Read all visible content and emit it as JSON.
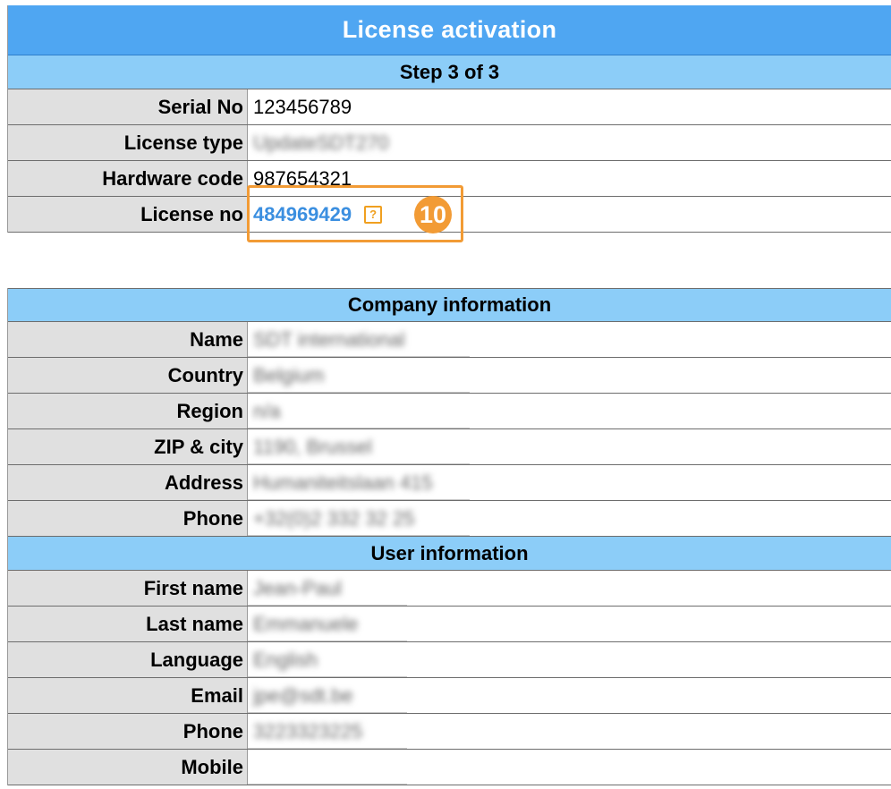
{
  "license": {
    "title": "License activation",
    "step": "Step 3 of 3",
    "rows": [
      {
        "label": "Serial No",
        "value": "123456789"
      },
      {
        "label": "License type",
        "value": "UpdateSDT270"
      },
      {
        "label": "Hardware code",
        "value": "987654321"
      },
      {
        "label": "License no",
        "value": "484969429"
      }
    ],
    "help_glyph": "?",
    "callout_number": "10"
  },
  "company": {
    "header": "Company information",
    "rows": [
      {
        "label": "Name",
        "value": "SDT international"
      },
      {
        "label": "Country",
        "value": "Belgium"
      },
      {
        "label": "Region",
        "value": "n/a"
      },
      {
        "label": "ZIP & city",
        "value": "1190, Brussel"
      },
      {
        "label": "Address",
        "value": "Humaniteitslaan 415"
      },
      {
        "label": "Phone",
        "value": "+32(0)2 332 32 25"
      }
    ]
  },
  "user": {
    "header": "User information",
    "rows": [
      {
        "label": "First name",
        "value": "Jean-Paul"
      },
      {
        "label": "Last name",
        "value": "Emmanuele"
      },
      {
        "label": "Language",
        "value": "English"
      },
      {
        "label": "Email",
        "value": "jpe@sdt.be"
      },
      {
        "label": "Phone",
        "value": "3223323225"
      },
      {
        "label": "Mobile",
        "value": ""
      }
    ]
  },
  "colors": {
    "title_bar": "#4fa6f2",
    "sub_bar": "#8ccdf8",
    "label_bg": "#e0e0e0",
    "link": "#3b8fe0",
    "callout": "#f29b35"
  }
}
